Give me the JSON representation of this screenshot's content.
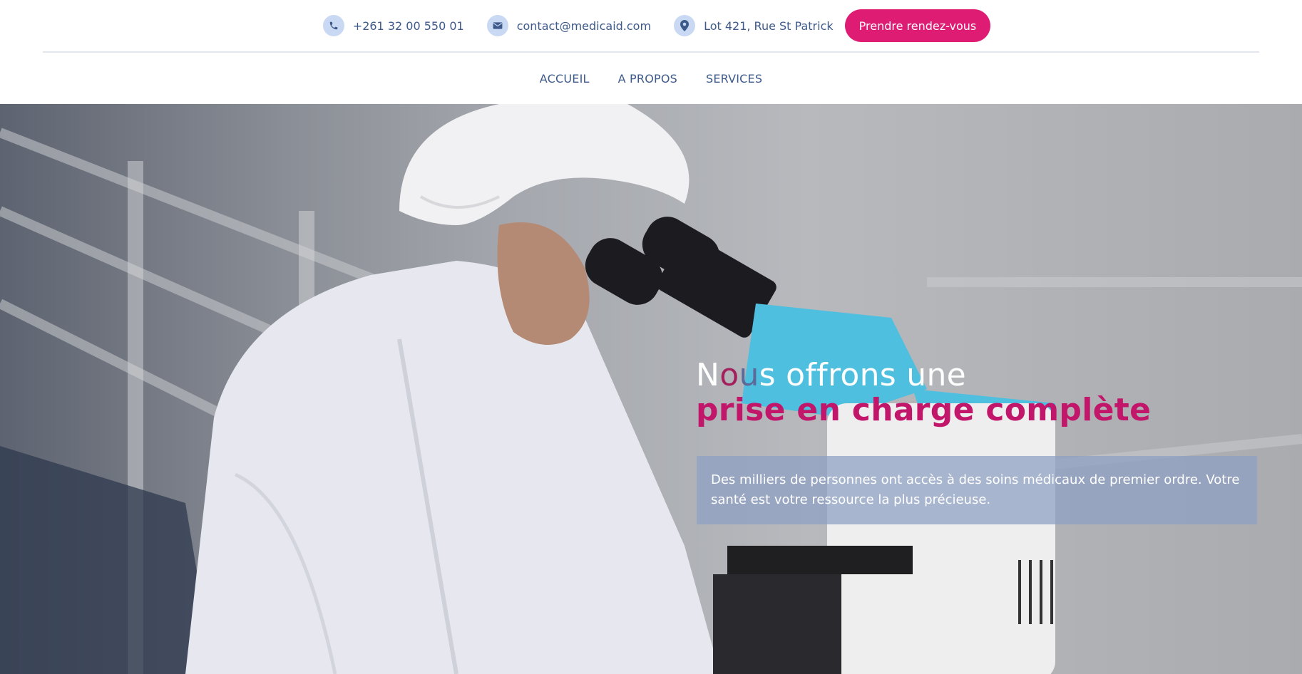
{
  "topbar": {
    "phone": {
      "icon": "phone-icon",
      "text": "+261 32 00 550 01"
    },
    "email": {
      "icon": "envelope-icon",
      "text": "contact@medicaid.com"
    },
    "address": {
      "icon": "map-pin-icon",
      "text": "Lot 421, Rue St Patrick"
    },
    "cta_label": "Prendre rendez-vous"
  },
  "nav": {
    "items": [
      {
        "label": "ACCUEIL"
      },
      {
        "label": "A PROPOS"
      },
      {
        "label": "SERVICES"
      }
    ]
  },
  "hero": {
    "heading_n": "N",
    "heading_o": "o",
    "heading_u": "u",
    "heading_rest": "s offrons une",
    "heading_line2": "prise en charge complète",
    "description": "Des milliers de personnes ont accès à des soins médicaux de premier ordre. Votre santé est votre ressource la plus précieuse."
  },
  "colors": {
    "accent": "#df1c74",
    "heading_accent": "#c2166a",
    "text": "#3d5a8a",
    "icon_bg": "#c9d9f3"
  }
}
